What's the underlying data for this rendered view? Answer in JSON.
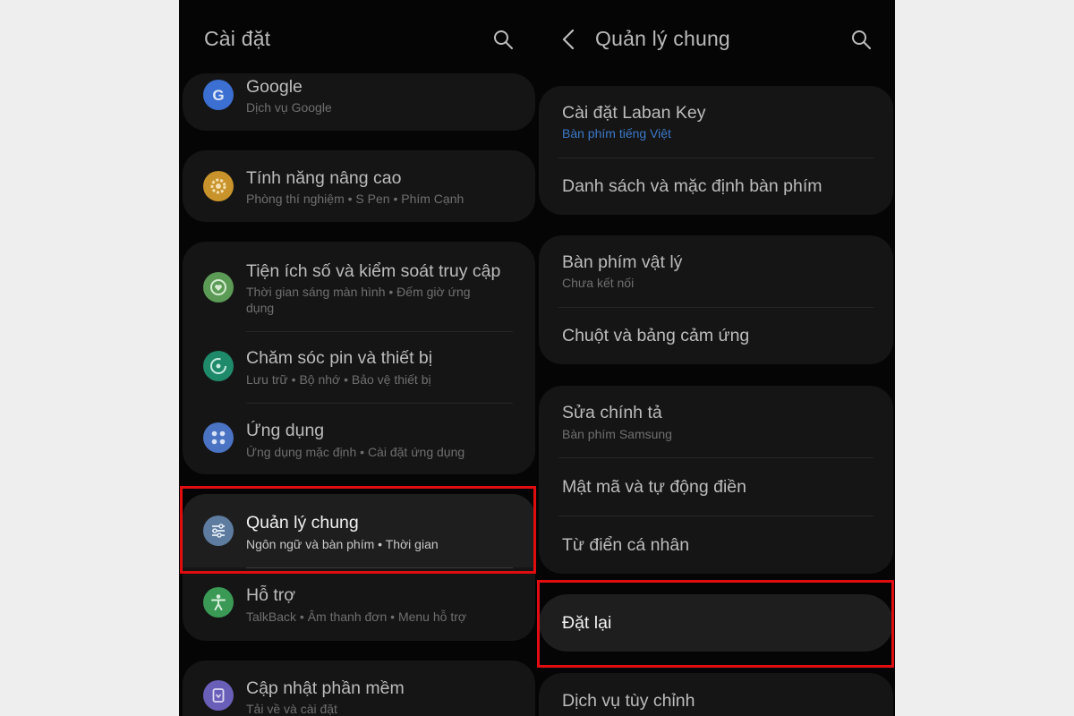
{
  "left": {
    "title": "Cài đặt",
    "items": [
      {
        "title": "Google",
        "subtitle": "Dịch vụ Google",
        "icon": "google-icon",
        "color": "#3b6fd1"
      },
      {
        "title": "Tính năng nâng cao",
        "subtitle": "Phòng thí nghiệm  •  S Pen  •  Phím Cạnh",
        "icon": "gear-icon",
        "color": "#c9932b"
      },
      {
        "title": "Tiện ích số và kiểm soát truy cập",
        "subtitle": "Thời gian sáng màn hình  •  Đếm giờ ứng",
        "subtitle2": "dụng",
        "icon": "heart-circle-icon",
        "color": "#5b9b55"
      },
      {
        "title": "Chăm sóc pin và thiết bị",
        "subtitle": "Lưu trữ  •  Bộ nhớ  •  Bảo vệ thiết bị",
        "icon": "refresh-icon",
        "color": "#1f8a6a"
      },
      {
        "title": "Ứng dụng",
        "subtitle": "Ứng dụng mặc định  •  Cài đặt ứng dụng",
        "icon": "apps-grid-icon",
        "color": "#4a73c4"
      },
      {
        "title": "Quản lý chung",
        "subtitle": "Ngôn ngữ và bàn phím  •  Thời gian",
        "icon": "sliders-icon",
        "color": "#5d7c9f"
      },
      {
        "title": "Hỗ trợ",
        "subtitle": "TalkBack  •  Âm thanh đơn  •  Menu hỗ trợ",
        "icon": "accessibility-icon",
        "color": "#3a9a55"
      },
      {
        "title": "Cập nhật phần mềm",
        "subtitle": "Tải về và cài đặt",
        "icon": "update-icon",
        "color": "#6a5fb8"
      }
    ]
  },
  "right": {
    "title": "Quản lý chung",
    "items": [
      {
        "title": "Cài đặt Laban Key",
        "subtitle": "Bàn phím tiếng Việt"
      },
      {
        "title": "Danh sách và mặc định bàn phím",
        "subtitle": ""
      },
      {
        "title": "Bàn phím vật lý",
        "subtitle": "Chưa kết nối"
      },
      {
        "title": "Chuột và bảng cảm ứng",
        "subtitle": ""
      },
      {
        "title": "Sửa chính tả",
        "subtitle": "Bàn phím Samsung"
      },
      {
        "title": "Mật mã và tự động điền",
        "subtitle": ""
      },
      {
        "title": "Từ điển cá nhân",
        "subtitle": ""
      },
      {
        "title": "Đặt lại",
        "subtitle": ""
      },
      {
        "title": "Dịch vụ tùy chỉnh",
        "subtitle": ""
      }
    ]
  },
  "colors": {
    "highlight": "#e00d10",
    "link": "#3c79c9",
    "card": "#151515",
    "background": "#050505"
  }
}
